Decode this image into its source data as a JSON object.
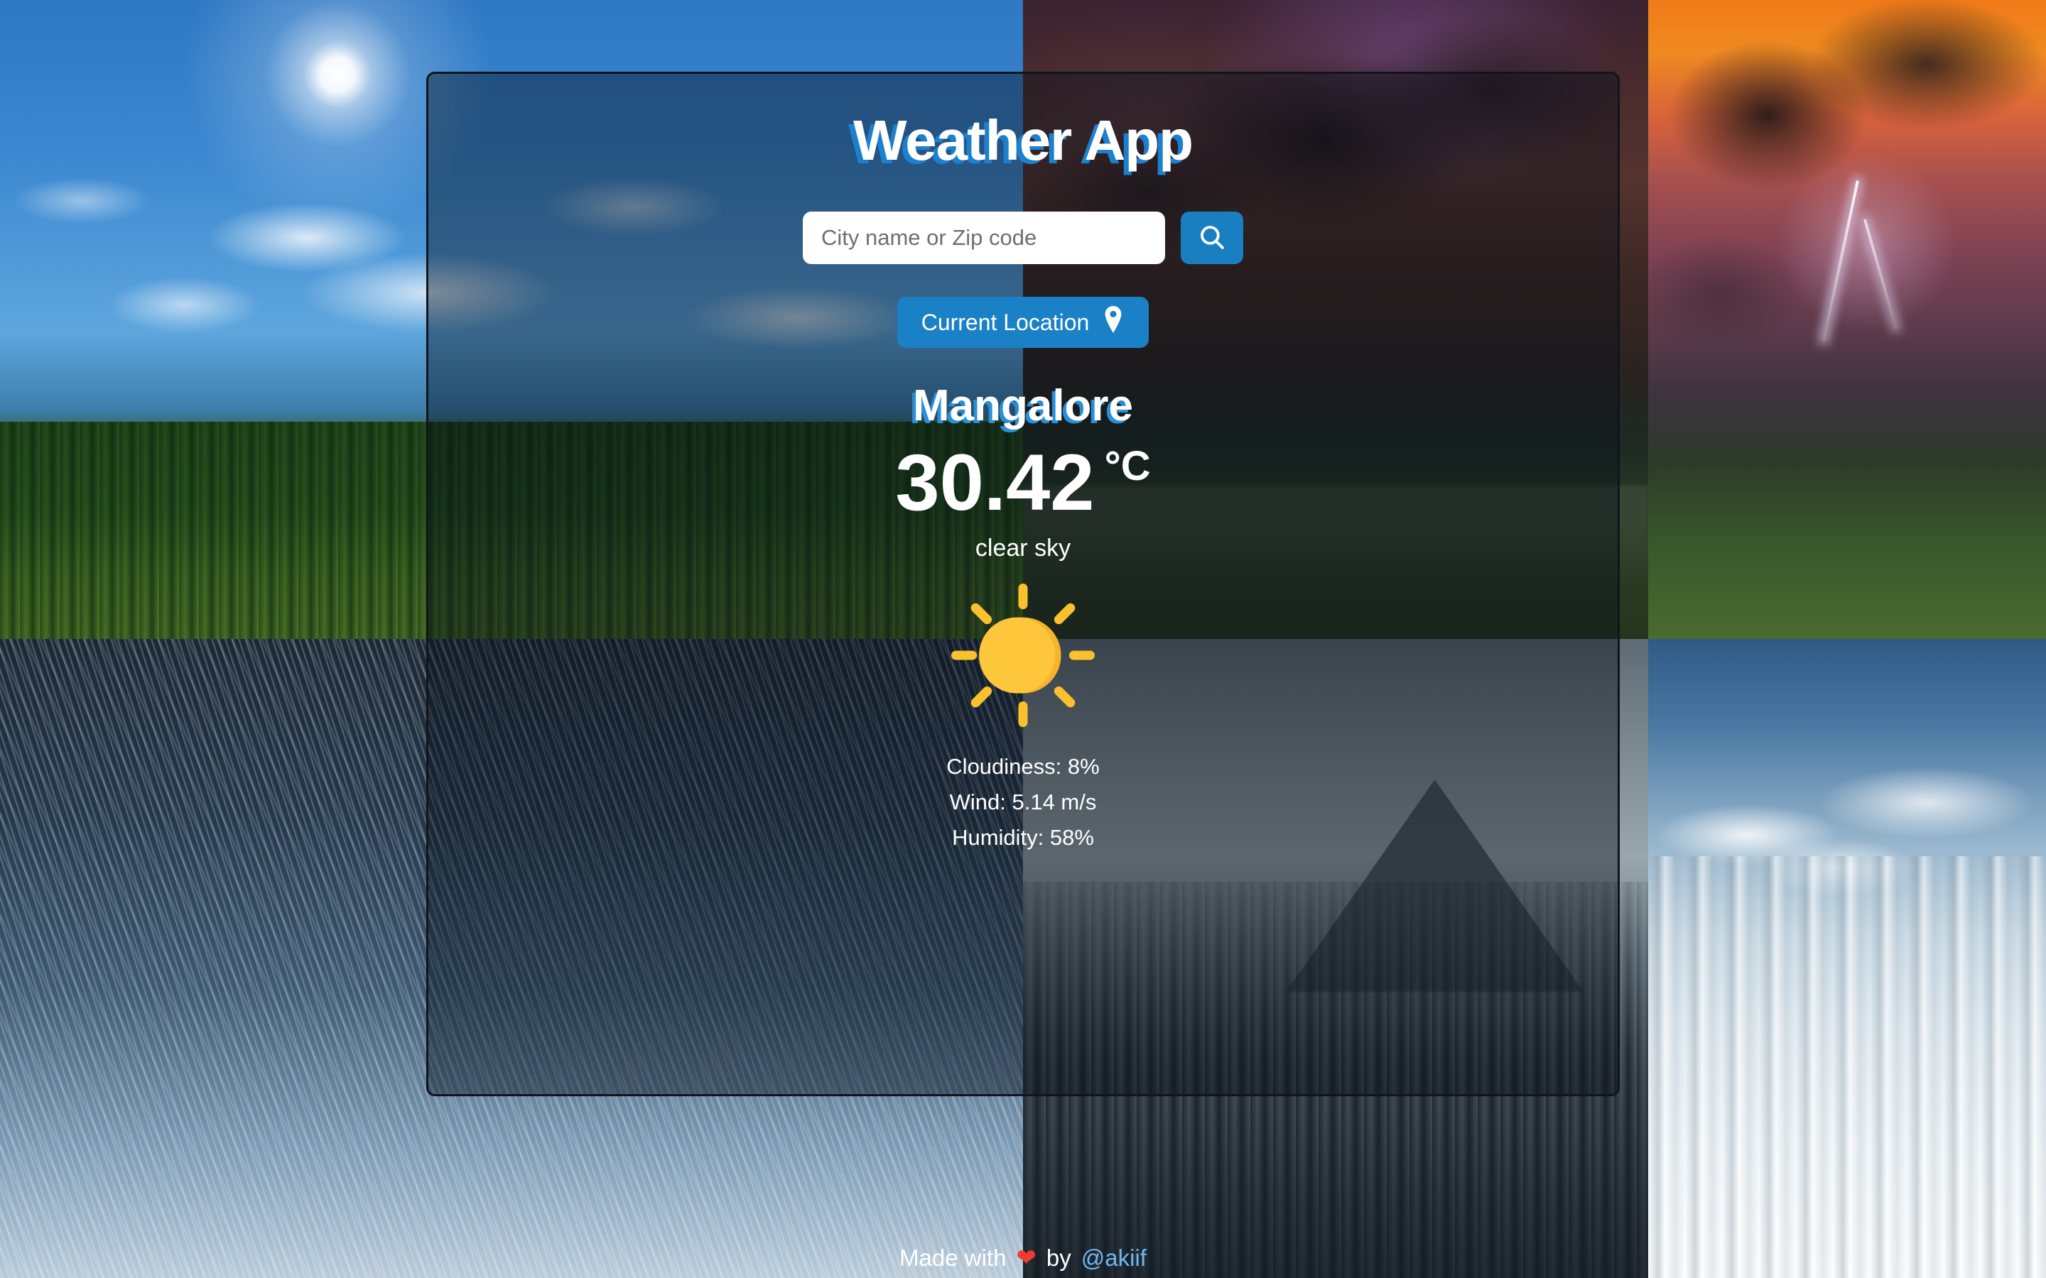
{
  "app": {
    "title": "Weather App"
  },
  "search": {
    "placeholder": "City name or Zip code",
    "value": "",
    "button_icon": "search-icon"
  },
  "location_button": {
    "label": "Current Location",
    "icon": "map-pin-icon"
  },
  "weather": {
    "city": "Mangalore",
    "temperature": "30.42",
    "unit": "°C",
    "description": "clear sky",
    "icon": "sun-clear-sky-icon",
    "details": [
      "Cloudiness: 8%",
      "Wind: 5.14 m/s",
      "Humidity: 58%"
    ]
  },
  "footer": {
    "made_with": "Made with",
    "heart": "❤",
    "by": "by",
    "handle": "@akiif"
  },
  "colors": {
    "accent_blue": "#1a81c6",
    "title_shadow_blue": "#1b81cf",
    "sun_yellow": "#fdc63b",
    "heart_red": "#ef3b33",
    "handle_blue": "#6fb7ef"
  },
  "background": {
    "tiles": [
      "clear-sunny-sky",
      "thunderstorm-clouds",
      "sunset-lightning",
      "heavy-rain",
      "misty-mountain-forest",
      "snowy-spruce-forest"
    ]
  }
}
